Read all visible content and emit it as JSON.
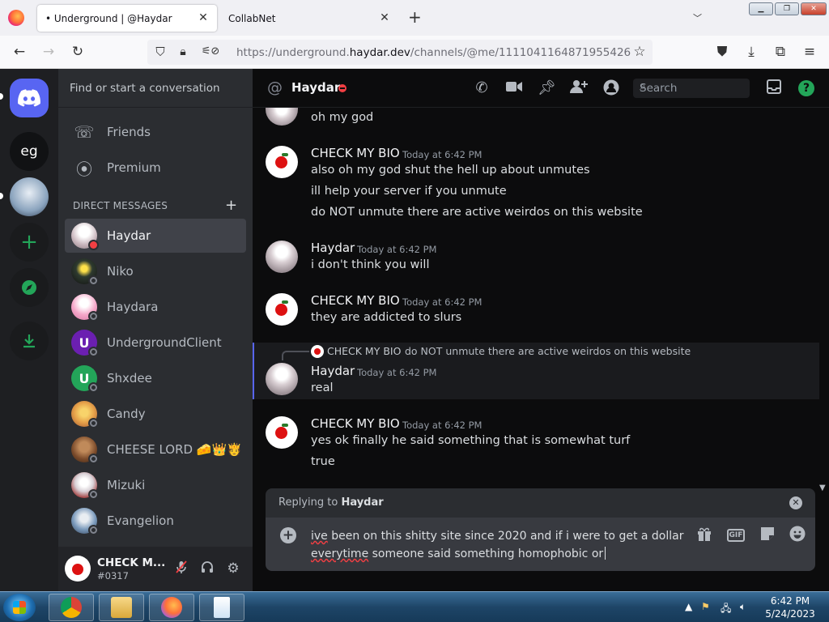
{
  "browser": {
    "tabs": [
      {
        "title": "• Underground | @Haydar",
        "active": true
      },
      {
        "title": "CollabNet",
        "active": false
      }
    ],
    "url_prefix": "https://underground.",
    "url_domain": "haydar.dev",
    "url_path": "/channels/@me/1111041164871955426",
    "icons": [
      "back-icon",
      "forward-icon",
      "reload-icon",
      "shield-icon",
      "lock-icon",
      "permissions-icon",
      "bookmark-star-icon",
      "pocket-icon",
      "downloads-icon",
      "extensions-icon",
      "menu-icon"
    ]
  },
  "guilds": [
    {
      "name": "discord-home",
      "label": ""
    },
    {
      "name": "eg",
      "label": "eg"
    },
    {
      "name": "anime-server",
      "label": ""
    },
    {
      "name": "add-server",
      "label": "+"
    },
    {
      "name": "explore",
      "label": ""
    },
    {
      "name": "download-apps",
      "label": ""
    }
  ],
  "sidebar": {
    "search_placeholder": "Find or start a conversation",
    "nav": [
      {
        "label": "Friends",
        "icon": "friends-icon"
      },
      {
        "label": "Premium",
        "icon": "nitro-icon"
      }
    ],
    "dm_header": "DIRECT MESSAGES",
    "dms": [
      {
        "name": "Haydar",
        "status": "dnd",
        "color": "#c9b6bd"
      },
      {
        "name": "Niko",
        "status": "offline",
        "color": "#2e3a2f"
      },
      {
        "name": "Haydara",
        "status": "offline",
        "color": "#f4a6c8"
      },
      {
        "name": "UndergroundClient",
        "status": "offline",
        "color": "#6b1fb1"
      },
      {
        "name": "Shxdee",
        "status": "offline",
        "color": "#23a559"
      },
      {
        "name": "Candy",
        "status": "offline",
        "color": "#e7a34b"
      },
      {
        "name": "CHEESE LORD 🧀👑🫅",
        "status": "offline",
        "color": "#7a4a2a"
      },
      {
        "name": "Mizuki",
        "status": "offline",
        "color": "#d8d0d6"
      },
      {
        "name": "Evangelion",
        "status": "offline",
        "color": "#7c9bbd"
      }
    ]
  },
  "user_panel": {
    "name": "CHECK M...",
    "tag": "#0317"
  },
  "channel": {
    "name": "Haydar",
    "search_placeholder": "Search"
  },
  "messages": [
    {
      "author": "",
      "timestamp": "",
      "lines": [
        "oh my god"
      ]
    },
    {
      "author": "CHECK MY BIO",
      "timestamp": "Today at 6:42 PM",
      "lines": [
        "also oh my god shut the hell up about unmutes",
        "ill help your server if you unmute",
        "do NOT unmute there are active weirdos on this website"
      ]
    },
    {
      "author": "Haydar",
      "timestamp": "Today at 6:42 PM",
      "lines": [
        "i don't think you will"
      ]
    },
    {
      "author": "CHECK MY BIO",
      "timestamp": "Today at 6:42 PM",
      "lines": [
        "they are addicted to slurs"
      ]
    },
    {
      "author": "Haydar",
      "timestamp": "Today at 6:42 PM",
      "lines": [
        "real"
      ],
      "reply_to": {
        "author": "CHECK MY BIO",
        "text": "do NOT unmute there are active weirdos on this website"
      }
    },
    {
      "author": "CHECK MY BIO",
      "timestamp": "Today at 6:42 PM",
      "lines": [
        "yes ok finally he said something that is somewhat turf",
        "true"
      ]
    }
  ],
  "composer": {
    "replying_prefix": "Replying to",
    "replying_name": "Haydar",
    "typo_word": "ive",
    "text_line1_rest": " been on this shitty site since 2020 and if i were to get a dollar",
    "text_line2_typo": "everytime",
    "text_line2_rest": " someone said something homophobic or",
    "gif_label": "GIF"
  },
  "taskbar": {
    "apps": [
      "chrome",
      "explorer",
      "firefox",
      "notepad"
    ],
    "time": "6:42 PM",
    "date": "5/24/2023"
  }
}
